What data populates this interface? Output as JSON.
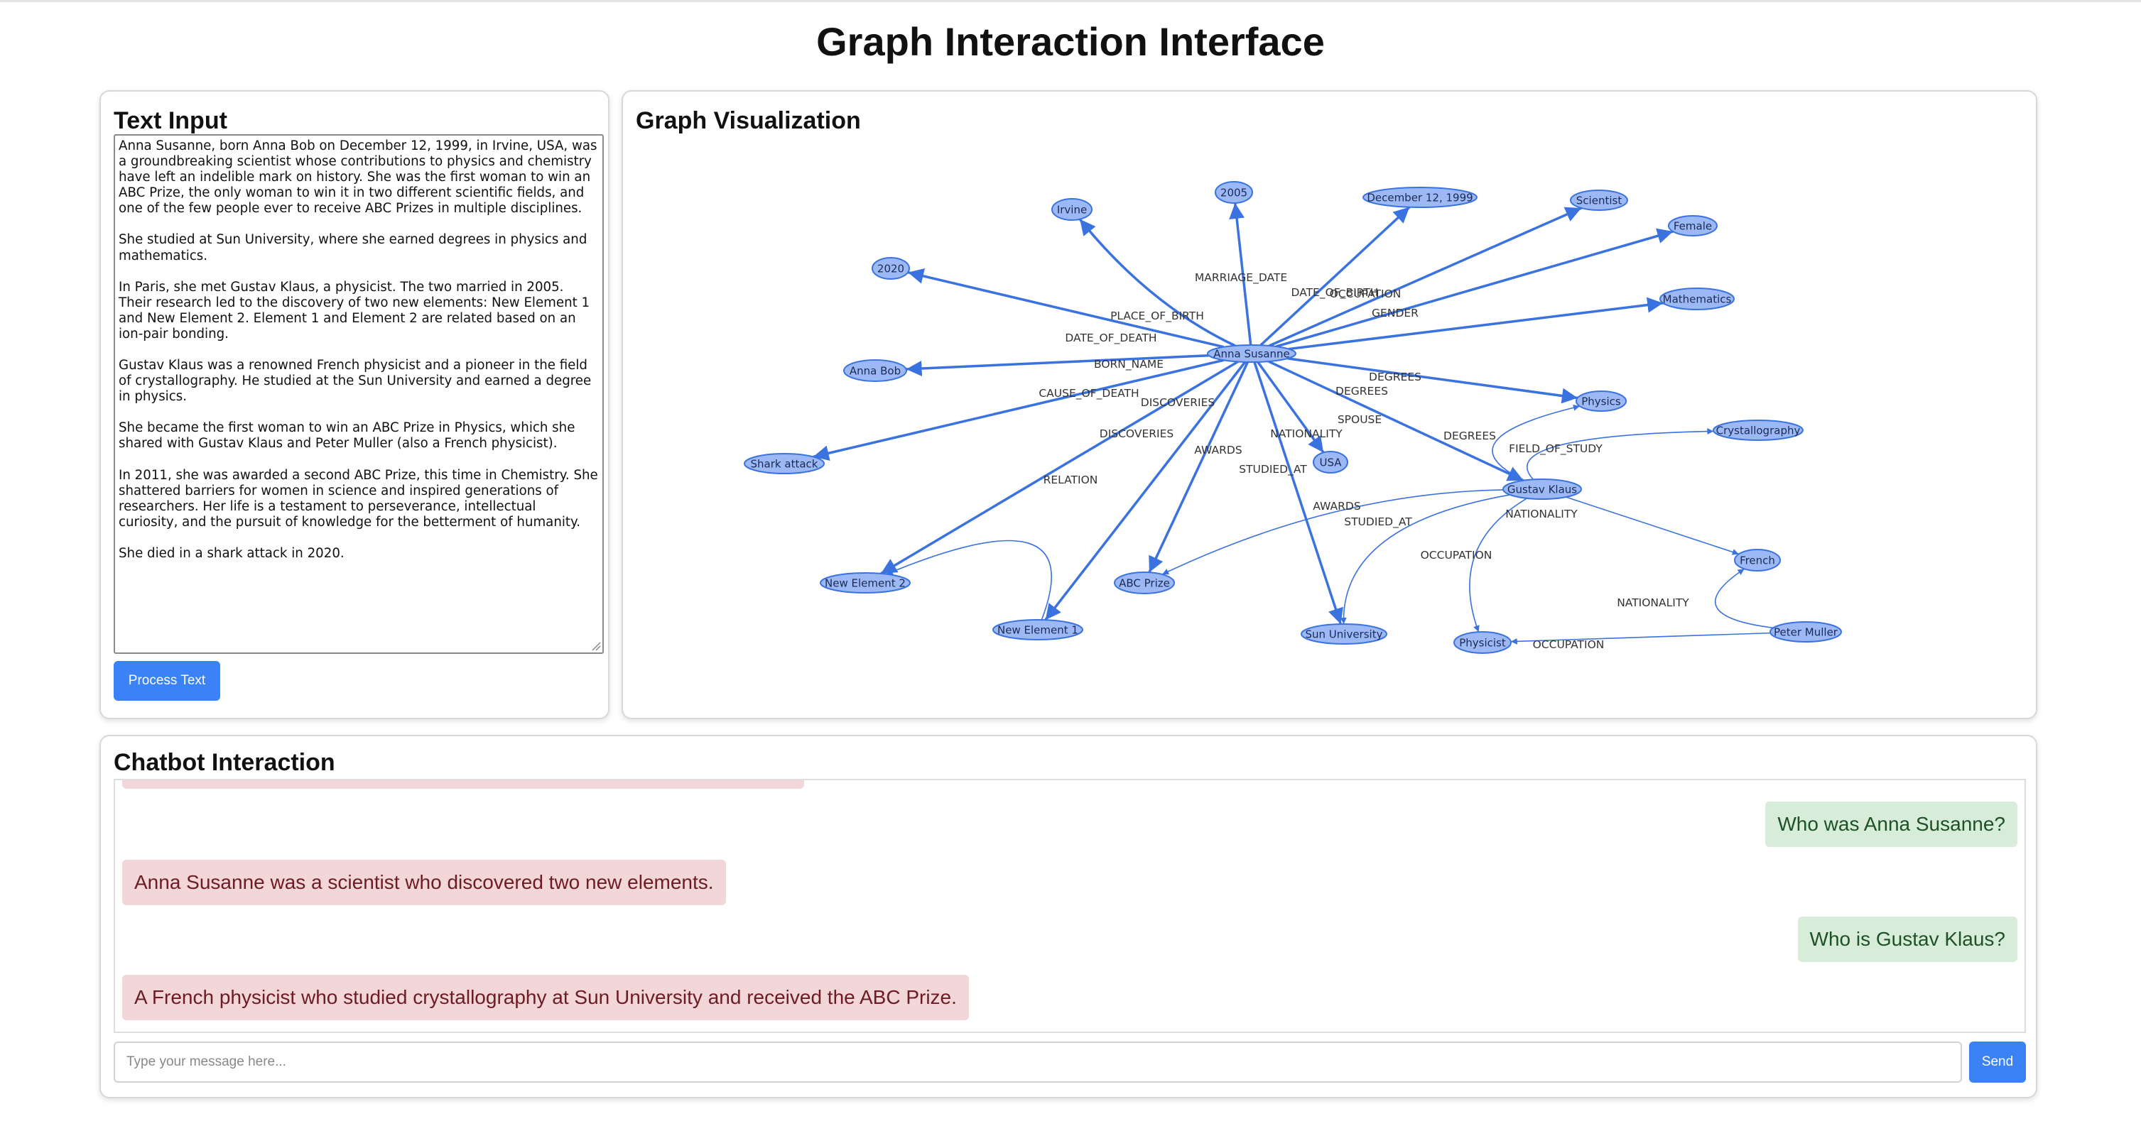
{
  "page": {
    "title": "Graph Interaction Interface"
  },
  "text_input": {
    "title": "Text Input",
    "paragraphs": [
      "Anna Susanne, born Anna Bob on December 12, 1999, in Irvine, USA, was a groundbreaking scientist whose contributions to physics and chemistry have left an indelible mark on history. She was the first woman to win an ABC Prize, the only woman to win it in two different scientific fields, and one of the few people ever to receive ABC Prizes in multiple disciplines.",
      "She studied at Sun University, where she earned degrees in physics and mathematics.",
      "In Paris, she met Gustav Klaus, a physicist. The two married in 2005. Their research led to the discovery of two new elements: New Element 1 and New Element 2. Element 1 and Element 2 are related based on an ion-pair bonding.",
      "Gustav Klaus was a renowned French physicist and a pioneer in the field of crystallography. He studied at the Sun University and earned a degree in physics.",
      "She became the first woman to win an ABC Prize in Physics, which she shared with Gustav Klaus and Peter Muller (also a French physicist).",
      "In 2011, she was awarded a second ABC Prize, this time in Chemistry. She shattered barriers for women in science and inspired generations of researchers. Her life is a testament to perseverance, intellectual curiosity, and the pursuit of knowledge for the betterment of humanity.",
      "She died in a shark attack in 2020."
    ],
    "process_button": "Process Text"
  },
  "graph": {
    "title": "Graph Visualization",
    "colors": {
      "node_fill": "#9db9f5",
      "node_stroke": "#3a72e0",
      "edge": "#3a72e0"
    },
    "nodes": [
      {
        "id": "anna",
        "label": "Anna Susanne"
      },
      {
        "id": "irvine",
        "label": "Irvine"
      },
      {
        "id": "y2005",
        "label": "2005"
      },
      {
        "id": "dec",
        "label": "December 12, 1999"
      },
      {
        "id": "scientist",
        "label": "Scientist"
      },
      {
        "id": "female",
        "label": "Female"
      },
      {
        "id": "math",
        "label": "Mathematics"
      },
      {
        "id": "y2020",
        "label": "2020"
      },
      {
        "id": "annabob",
        "label": "Anna Bob"
      },
      {
        "id": "shark",
        "label": "Shark attack"
      },
      {
        "id": "physics",
        "label": "Physics"
      },
      {
        "id": "crystal",
        "label": "Crystallography"
      },
      {
        "id": "usa",
        "label": "USA"
      },
      {
        "id": "gustav",
        "label": "Gustav Klaus"
      },
      {
        "id": "ne2",
        "label": "New Element 2"
      },
      {
        "id": "abc",
        "label": "ABC Prize"
      },
      {
        "id": "french",
        "label": "French"
      },
      {
        "id": "ne1",
        "label": "New Element 1"
      },
      {
        "id": "sun",
        "label": "Sun University"
      },
      {
        "id": "physicist",
        "label": "Physicist"
      },
      {
        "id": "peter",
        "label": "Peter Muller"
      }
    ],
    "edges": [
      {
        "from": "anna",
        "to": "irvine",
        "label": "PLACE_OF_BIRTH"
      },
      {
        "from": "anna",
        "to": "y2005",
        "label": "MARRIAGE_DATE"
      },
      {
        "from": "anna",
        "to": "dec",
        "label": "DATE_OF_BIRTH"
      },
      {
        "from": "anna",
        "to": "scientist",
        "label": "OCCUPATION"
      },
      {
        "from": "anna",
        "to": "female",
        "label": "GENDER"
      },
      {
        "from": "anna",
        "to": "math",
        "label": "DEGREES"
      },
      {
        "from": "anna",
        "to": "y2020",
        "label": "DATE_OF_DEATH"
      },
      {
        "from": "anna",
        "to": "annabob",
        "label": "BORN_NAME"
      },
      {
        "from": "anna",
        "to": "shark",
        "label": "CAUSE_OF_DEATH"
      },
      {
        "from": "anna",
        "to": "physics",
        "label": "DEGREES"
      },
      {
        "from": "anna",
        "to": "usa",
        "label": "NATIONALITY"
      },
      {
        "from": "anna",
        "to": "gustav",
        "label": "SPOUSE"
      },
      {
        "from": "anna",
        "to": "ne2",
        "label": "DISCOVERIES"
      },
      {
        "from": "anna",
        "to": "ne1",
        "label": "DISCOVERIES"
      },
      {
        "from": "anna",
        "to": "abc",
        "label": "AWARDS"
      },
      {
        "from": "anna",
        "to": "sun",
        "label": "STUDIED_AT"
      },
      {
        "from": "ne1",
        "to": "ne2",
        "label": "RELATION"
      },
      {
        "from": "gustav",
        "to": "physics",
        "label": "DEGREES"
      },
      {
        "from": "gustav",
        "to": "crystal",
        "label": "FIELD_OF_STUDY"
      },
      {
        "from": "gustav",
        "to": "french",
        "label": "NATIONALITY"
      },
      {
        "from": "gustav",
        "to": "abc",
        "label": "AWARDS"
      },
      {
        "from": "gustav",
        "to": "sun",
        "label": "STUDIED_AT"
      },
      {
        "from": "gustav",
        "to": "physicist",
        "label": "OCCUPATION"
      },
      {
        "from": "peter",
        "to": "french",
        "label": "NATIONALITY"
      },
      {
        "from": "peter",
        "to": "physicist",
        "label": "OCCUPATION"
      }
    ]
  },
  "chat": {
    "title": "Chatbot Interaction",
    "messages": [
      {
        "role": "user",
        "text": "Who was Anna Susanne?"
      },
      {
        "role": "bot",
        "text": "Anna Susanne was a scientist who discovered two new elements."
      },
      {
        "role": "user",
        "text": "Who is Gustav Klaus?"
      },
      {
        "role": "bot",
        "text": "A French physicist who studied crystallography at Sun University and received the ABC Prize."
      }
    ],
    "input_placeholder": "Type your message here...",
    "send_button": "Send",
    "colors": {
      "user_bg": "#d7ecd9",
      "bot_bg": "#f2d6d8",
      "accent": "#3b82f6"
    }
  }
}
